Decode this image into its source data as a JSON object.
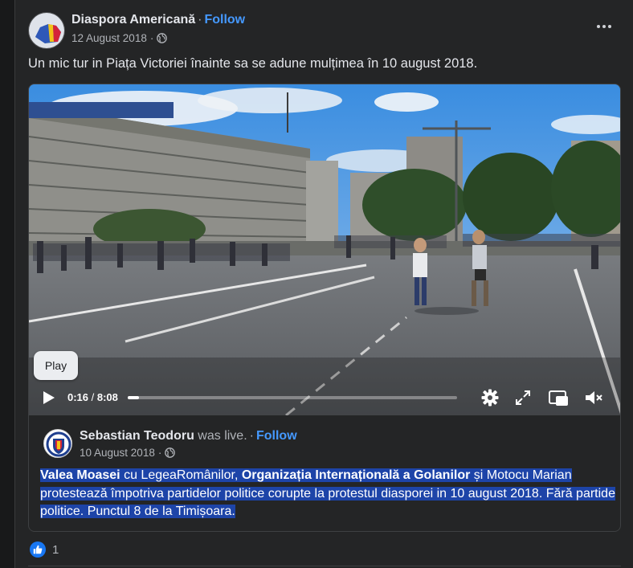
{
  "post": {
    "author": "Diaspora Americană",
    "separator": "·",
    "follow_label": "Follow",
    "date": "12 August 2018",
    "privacy_icon": "globe-icon",
    "more_icon": "more-options-icon",
    "text": "Un mic tur in Piața Victoriei înainte sa se adune mulțimea în 10 august 2018."
  },
  "video": {
    "tooltip": "Play",
    "current_time": "0:16",
    "time_separator": " / ",
    "duration": "8:08",
    "progress_fraction": 0.033,
    "icons": [
      "play-icon",
      "settings-gear-icon",
      "fullscreen-expand-icon",
      "picture-in-picture-icon",
      "muted-speaker-icon"
    ]
  },
  "shared": {
    "author": "Sebastian Teodoru",
    "was_live": "was live.",
    "separator": "·",
    "follow_label": "Follow",
    "date": "10 August 2018",
    "privacy_icon": "globe-icon",
    "text_parts": {
      "p1": "Valea Moasei",
      "p2": " cu LegeaRomânilor, ",
      "p3": "Organizația Internațională a Golanilor",
      "p4": " și Motocu Marian protestează împotriva partidelor politice corupte la protestul diasporei in 10 august 2018. Fără partide politice. Punctul 8 de la Timișoara."
    }
  },
  "reactions": {
    "icon": "like-thumb-icon",
    "count": "1"
  },
  "colors": {
    "background": "#18191a",
    "card": "#242526",
    "link": "#4599ff",
    "selection": "#1d44a8",
    "like": "#1877f2"
  }
}
